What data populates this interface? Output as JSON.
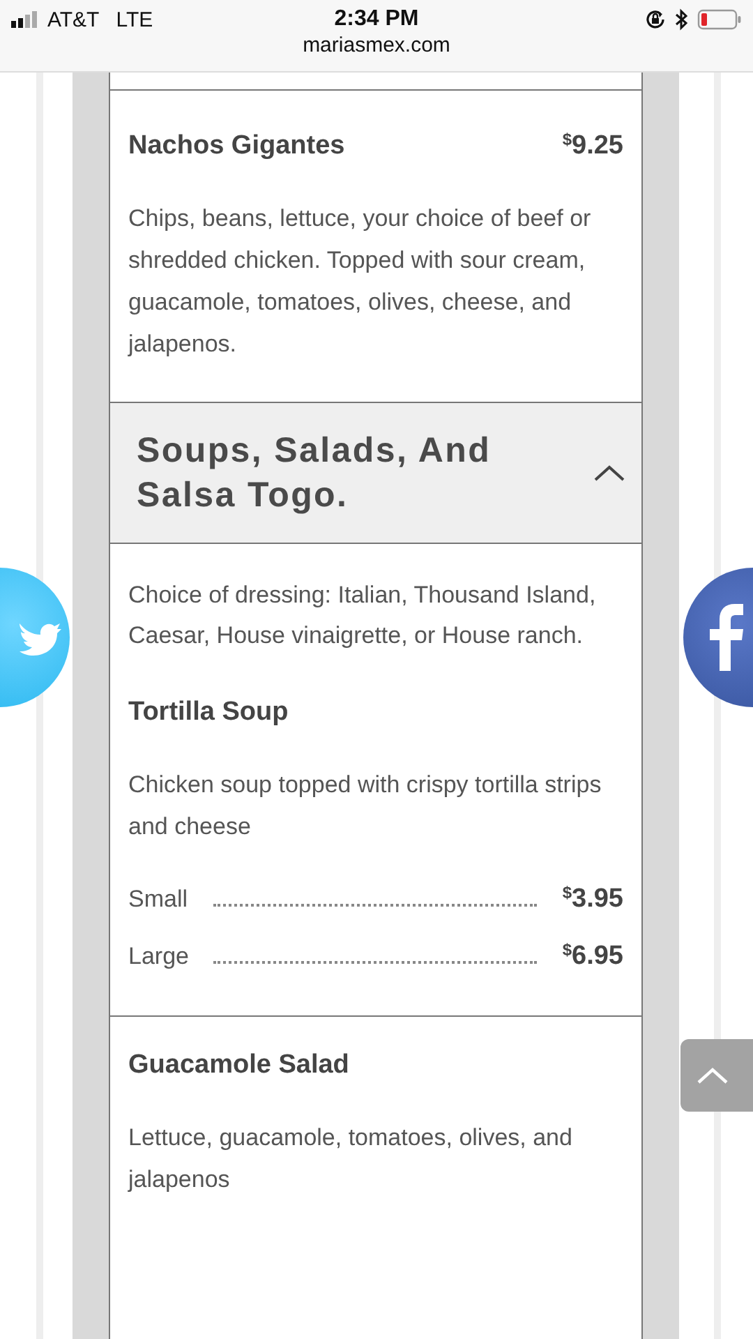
{
  "status_bar": {
    "carrier": "AT&T",
    "network": "LTE",
    "time": "2:34 PM",
    "url": "mariasmex.com"
  },
  "blocks": [
    {
      "kind": "items",
      "entries": [
        {
          "kind": "item",
          "name": "Nachos Gigantes",
          "price": {
            "currency": "$",
            "amount": "9.25"
          },
          "description": "Chips, beans, lettuce, your choice of beef or shredded chicken. Topped with sour cream, guacamole, tomatoes, olives, cheese, and jalapenos."
        }
      ]
    },
    {
      "kind": "section",
      "title": "Soups, Salads, And Salsa Togo.",
      "expanded": true
    },
    {
      "kind": "items",
      "entries": [
        {
          "kind": "note",
          "text": "Choice of dressing: Italian, Thousand Island, Caesar, House vinaigrette, or House ranch."
        },
        {
          "kind": "item",
          "name": "Tortilla Soup",
          "description": "Chicken soup topped with crispy tortilla strips and cheese",
          "sizes": [
            {
              "label": "Small",
              "price": {
                "currency": "$",
                "amount": "3.95"
              }
            },
            {
              "label": "Large",
              "price": {
                "currency": "$",
                "amount": "6.95"
              }
            }
          ]
        }
      ]
    },
    {
      "kind": "items",
      "entries": [
        {
          "kind": "item",
          "name": "Guacamole Salad",
          "description": "Lettuce, guacamole, tomatoes, olives, and jalapenos"
        }
      ]
    }
  ]
}
